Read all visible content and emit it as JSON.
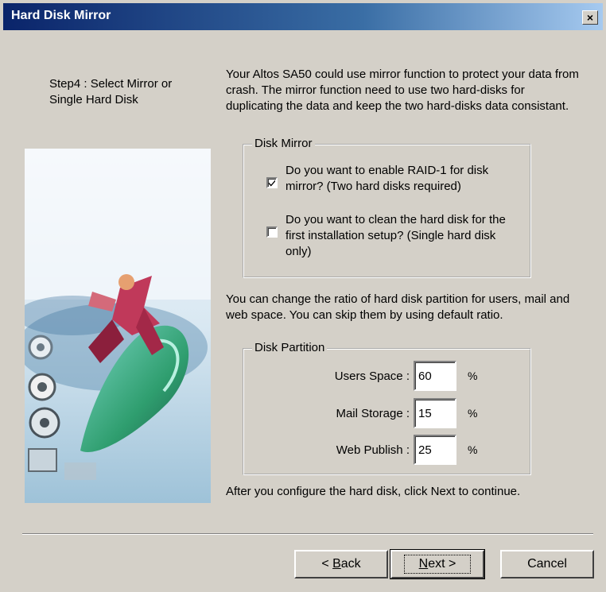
{
  "window": {
    "title": "Hard Disk Mirror",
    "close_label": "×"
  },
  "step_text": "Step4 : Select Mirror or Single Hard Disk",
  "intro_text": "Your Altos SA50 could use mirror function to protect your data from crash. The mirror function need to use two hard-disks for duplicating the data and keep the two hard-disks data consistant.",
  "disk_mirror": {
    "legend": "Disk Mirror",
    "options": [
      {
        "label": "Do you want to enable RAID-1 for disk mirror? (Two hard disks required)",
        "checked": true
      },
      {
        "label": "Do you want to clean the hard disk for the first installation setup? (Single hard disk only)",
        "checked": false
      }
    ]
  },
  "partition_text": "You can change the ratio of hard disk partition for users, mail and web space. You can skip them by using default ratio.",
  "disk_partition": {
    "legend": "Disk Partition",
    "fields": [
      {
        "label": "Users Space :",
        "value": "60",
        "unit": "%"
      },
      {
        "label": "Mail Storage :",
        "value": "15",
        "unit": "%"
      },
      {
        "label": "Web Publish :",
        "value": "25",
        "unit": "%"
      }
    ]
  },
  "footer_text": "After you configure the hard disk, click Next to continue.",
  "buttons": {
    "back": {
      "pre": "< ",
      "accel": "B",
      "post": "ack"
    },
    "next": {
      "accel": "N",
      "post": "ext >"
    },
    "cancel": "Cancel"
  }
}
